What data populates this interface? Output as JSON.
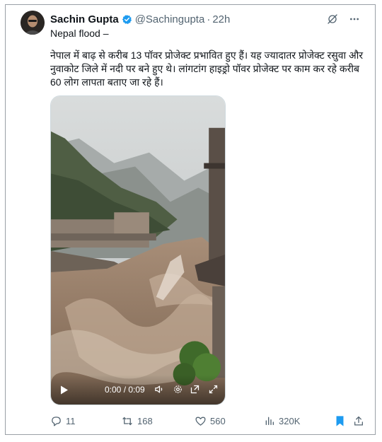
{
  "tweet": {
    "author_name": "Sachin Gupta",
    "handle": "@Sachingupta",
    "separator": "·",
    "time": "22h",
    "subtitle": "Nepal flood –",
    "text": "नेपाल में बाढ़ से करीब 13 पॉवर प्रोजेक्ट प्रभावित हुए हैं। यह ज्यादातर प्रोजेक्ट रसुवा और नुवाकोट जिले में नदी पर बने हुए थे। लांगटांग हाइड्रो पॉवर प्रोजेक्ट पर काम कर रहे करीब 60 लोग लापता बताए जा रहे हैं।",
    "verified_color": "#1d9bf0",
    "icons": [
      "grok-icon",
      "more-icon",
      "verified-icon"
    ]
  },
  "video": {
    "time_readout": "0:00 / 0:09",
    "controls": [
      "play-icon",
      "volume-icon",
      "settings-icon",
      "pip-icon",
      "fullscreen-icon"
    ]
  },
  "actions": {
    "replies": "11",
    "retweets": "168",
    "likes": "560",
    "views": "320K",
    "bookmark_color": "#1d9bf0",
    "icons": [
      "reply-icon",
      "retweet-icon",
      "like-icon",
      "views-icon",
      "bookmark-icon",
      "share-icon"
    ]
  }
}
